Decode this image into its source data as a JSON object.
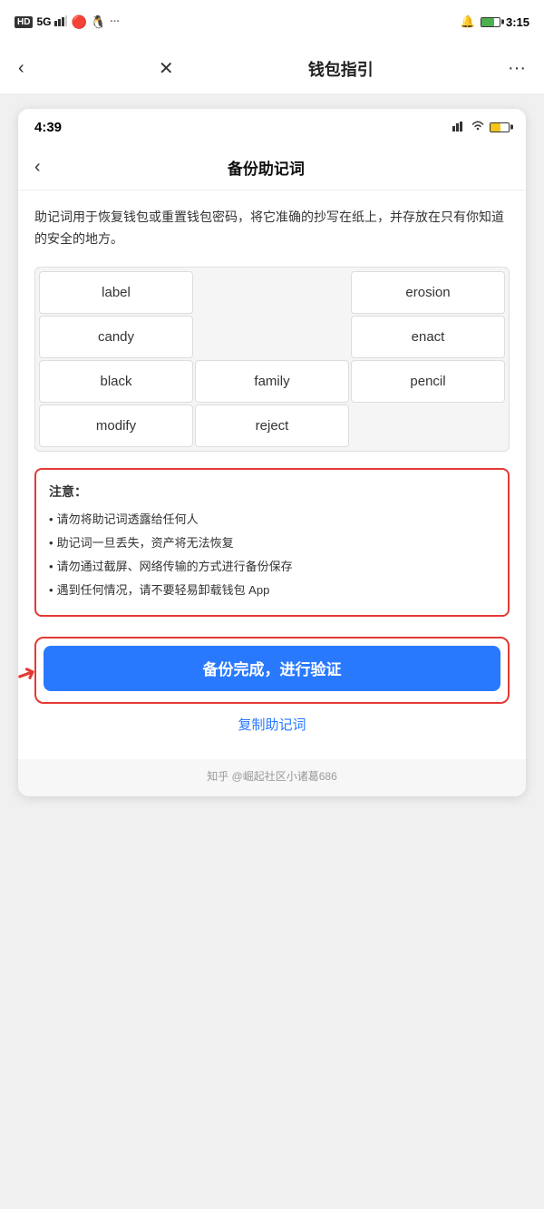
{
  "outer": {
    "status_time": "3:15",
    "status_icons": [
      "HD",
      "5G",
      "signal",
      "weibo",
      "qq",
      "more"
    ],
    "nav_back": "‹",
    "nav_close": "✕",
    "nav_title": "钱包指引",
    "nav_more": "···"
  },
  "inner": {
    "status_time": "4:39",
    "page_title": "备份助记词",
    "description": "助记词用于恢复钱包或重置钱包密码，将它准确的抄写在纸上，并存放在只有你知道的安全的地方。",
    "mnemonic_words": [
      "label",
      "",
      "erosion",
      "candy",
      "",
      "enact",
      "black",
      "family",
      "pencil",
      "modify",
      "reject",
      ""
    ],
    "warning_title": "注意：",
    "warning_items": [
      "请勿将助记词透露给任何人",
      "助记词一旦丢失，资产将无法恢复",
      "请勿通过截屏、网络传输的方式进行备份保存",
      "遇到任何情况，请不要轻易卸载钱包 App"
    ],
    "confirm_button": "备份完成，进行验证",
    "copy_link": "复制助记词",
    "footer": "知乎 @崛起社区小诸葛686"
  }
}
